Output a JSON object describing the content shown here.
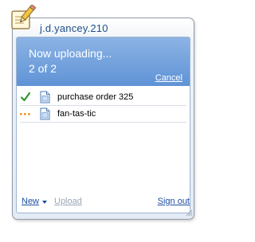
{
  "window": {
    "title": "j.d.yancey.210",
    "app_icon": "notepad-pencil-icon"
  },
  "upload": {
    "status": "Now uploading...",
    "progress": "2 of 2",
    "cancel_label": "Cancel"
  },
  "files": [
    {
      "name": "purchase order 325",
      "state": "uploaded",
      "state_icon": "check-icon",
      "file_icon": "document-icon"
    },
    {
      "name": "fan-tas-tic",
      "state": "uploading",
      "state_icon": "ellipsis-icon",
      "file_icon": "document-icon"
    }
  ],
  "footer": {
    "new_label": "New",
    "upload_label": "Upload",
    "upload_enabled": false,
    "signout_label": "Sign out"
  },
  "colors": {
    "banner": "#6b9ddc",
    "link": "#1d4fa3",
    "title": "#1f4f86",
    "check": "#2c9a2c",
    "pending": "#e89a2b"
  }
}
